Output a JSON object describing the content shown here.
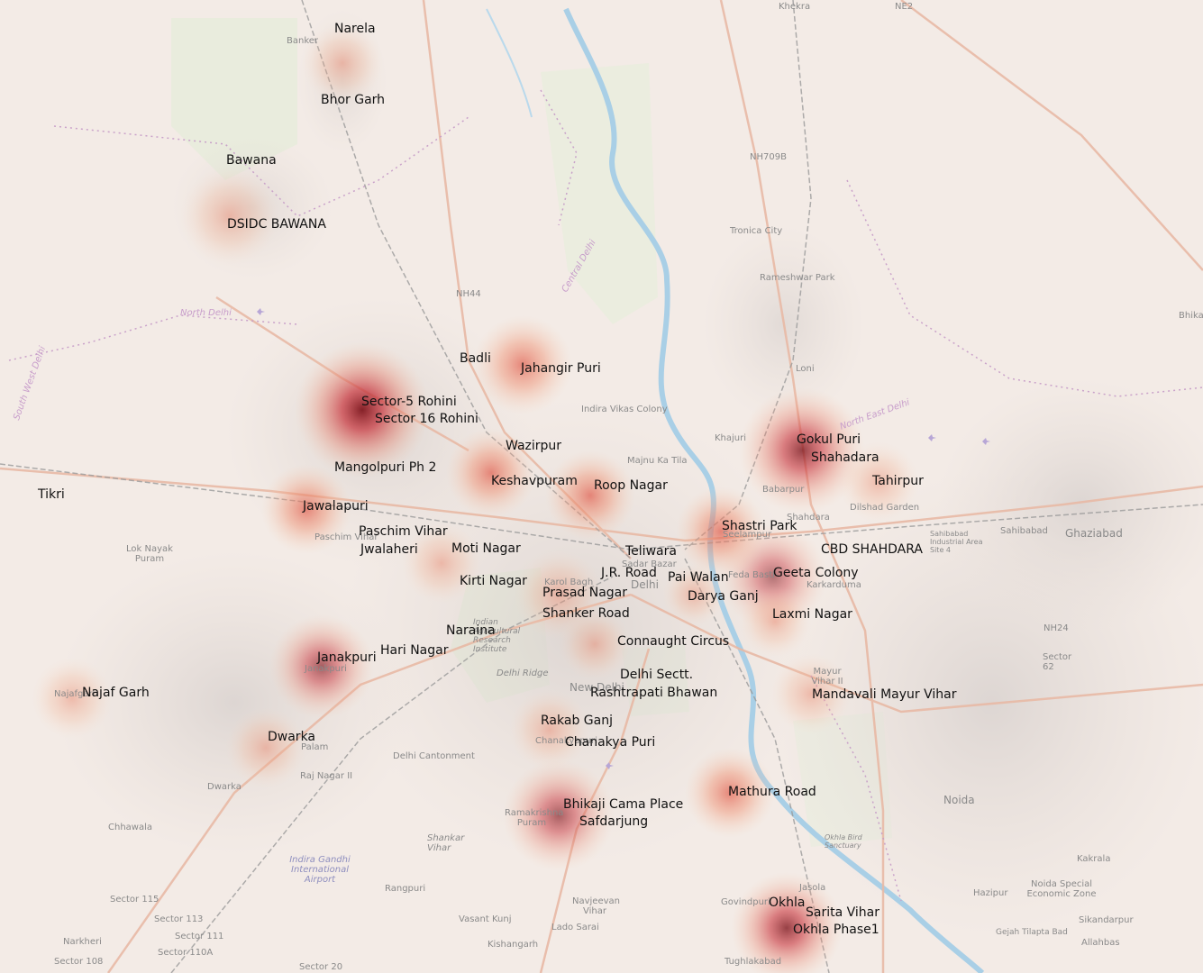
{
  "map": {
    "hotspots": [
      {
        "name": "Sector-5 Rohini",
        "intensity": 1.0
      },
      {
        "name": "Gokul Puri",
        "intensity": 0.85
      },
      {
        "name": "Okhla",
        "intensity": 0.85
      },
      {
        "name": "Janakpuri",
        "intensity": 0.75
      },
      {
        "name": "Bhikaji Cama Place",
        "intensity": 0.75
      },
      {
        "name": "Geeta Colony",
        "intensity": 0.7
      },
      {
        "name": "Jahangir Puri",
        "intensity": 0.6
      },
      {
        "name": "Keshavpuram",
        "intensity": 0.55
      },
      {
        "name": "Roop Nagar",
        "intensity": 0.55
      },
      {
        "name": "Shastri Park",
        "intensity": 0.6
      },
      {
        "name": "Mathura Road",
        "intensity": 0.55
      },
      {
        "name": "Jawalapuri",
        "intensity": 0.55
      },
      {
        "name": "Moti Nagar",
        "intensity": 0.45
      },
      {
        "name": "Prasad Nagar",
        "intensity": 0.45
      },
      {
        "name": "Mandavali Mayur Vihar",
        "intensity": 0.45
      },
      {
        "name": "Tahirpur",
        "intensity": 0.45
      },
      {
        "name": "Najaf Garh",
        "intensity": 0.35
      },
      {
        "name": "Dwarka",
        "intensity": 0.35
      },
      {
        "name": "DSIDC BAWANA",
        "intensity": 0.35
      },
      {
        "name": "Narela",
        "intensity": 0.3
      },
      {
        "name": "Connaught Circus",
        "intensity": 0.35
      },
      {
        "name": "Rakab Ganj",
        "intensity": 0.4
      },
      {
        "name": "Laxmi Nagar",
        "intensity": 0.4
      },
      {
        "name": "Darya Ganj",
        "intensity": 0.35
      }
    ],
    "station_labels": [
      "Narela",
      "Bhor Garh",
      "Bawana",
      "DSIDC BAWANA",
      "Badli",
      "Jahangir Puri",
      "Sector-5  Rohini",
      "Sector 16 Rohini",
      "Wazirpur",
      "Mangolpuri Ph 2",
      "Keshavpuram",
      "Roop Nagar",
      "Tikri",
      "Jawalapuri",
      "Paschim Vihar",
      "Jwalaheri",
      "Moti Nagar",
      "Teliwara",
      "J.R. Road",
      "Pai Walan",
      "Kirti Nagar",
      "Prasad Nagar",
      "Darya Ganj",
      "Shanker Road",
      "Naraina",
      "Connaught Circus",
      "Janakpuri",
      "Hari Nagar",
      "Delhi Sectt.",
      "Rashtrapati Bhawan",
      "Najaf Garh",
      "Rakab Ganj",
      "Dwarka",
      "Chanakya Puri",
      "Bhikaji Cama Place",
      "Safdarjung",
      "Mathura Road",
      "Okhla",
      "Sarita  Vihar",
      "Okhla Phase1",
      "Gokul Puri",
      "Shahadara",
      "Tahirpur",
      "Shastri Park",
      "CBD SHAHDARA",
      "Geeta Colony",
      "Laxmi Nagar",
      "Mandavali Mayur Vihar"
    ],
    "base_labels": [
      "Khekra",
      "NE2",
      "Banker",
      "Tronica City",
      "Rameshwar Park",
      "NH709B",
      "Loni",
      "Indira Vikas Colony",
      "Majnu Ka Tila",
      "Khajuri",
      "Babarpur",
      "Shahdara",
      "Dilshad Garden",
      "Seelampur",
      "Sahibabad Industrial Area Site 4",
      "Sahibabad",
      "Ghaziabad",
      "Bhikan",
      "Lok Nayak Puram",
      "Paschim Vihar",
      "Sadar Bazar",
      "Karol Bagh",
      "Delhi",
      "Feda Basti",
      "Karkarduma",
      "Indian Agricultural Research Institute",
      "New Delhi",
      "Delhi Ridge",
      "Janakpuri",
      "Najafgarh",
      "Palam",
      "Chanakyapuri",
      "Delhi Cantonment",
      "Raj Nagar II",
      "Dwarka",
      "Chhawala",
      "Mayur Vihar II",
      "Noida",
      "NH24",
      "Sector 62",
      "Ramakrishna Puram",
      "Shankar Vihar",
      "Indira Gandhi International Airport",
      "Rangpuri",
      "Vasant Kunj",
      "Navjeevan Vihar",
      "Lado Sarai",
      "Kishangarh",
      "Govindpuri",
      "Jasola",
      "Okhla Bird Sanctuary",
      "Kakrala",
      "Hazipur",
      "Noida Special Economic Zone",
      "Sikandarpur",
      "Gejah Tilapta Bad",
      "Allahbas",
      "Tughlakabad",
      "Sector 115",
      "Sector 113",
      "Sector 111",
      "Sector 110A",
      "Sector 108",
      "Sector 20",
      "Narkheri",
      "NH44",
      "North Delhi",
      "Central Delhi",
      "North East Delhi",
      "South West Delhi"
    ]
  }
}
